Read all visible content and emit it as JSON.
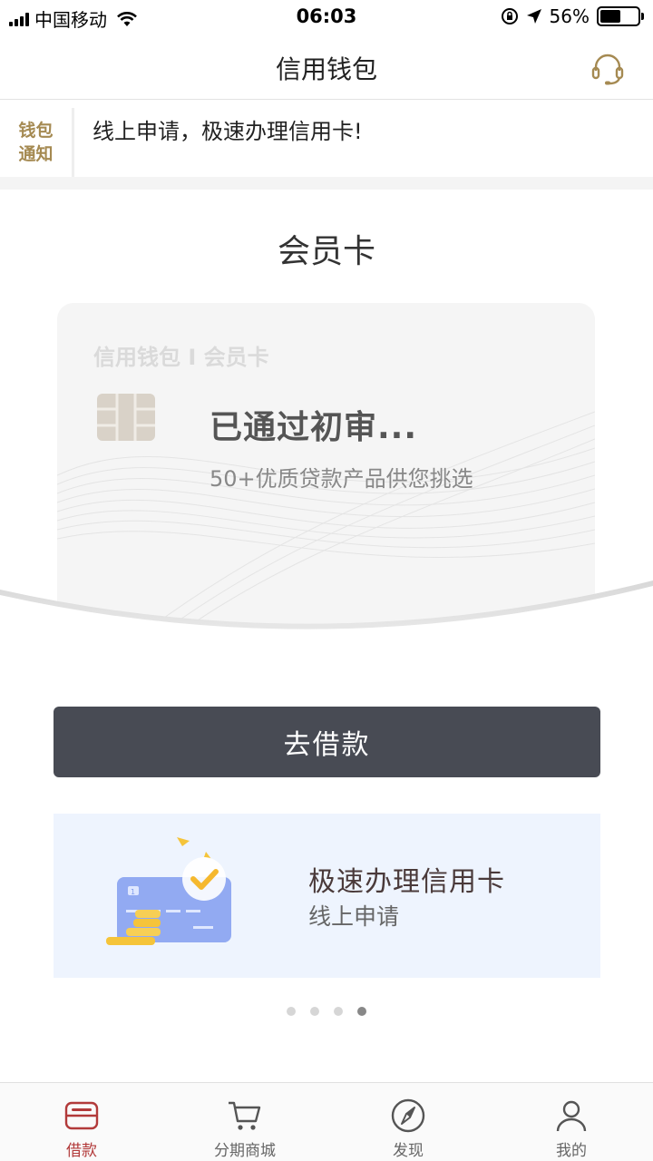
{
  "status_bar": {
    "carrier": "中国移动",
    "time": "06:03",
    "battery": "56%",
    "battery_level": 0.56
  },
  "nav": {
    "title": "信用钱包",
    "service_icon": "headset-icon"
  },
  "notice": {
    "tag_line1": "钱包",
    "tag_line2": "通知",
    "text": "线上申请，极速办理信用卡!"
  },
  "member": {
    "section_title": "会员卡",
    "card_brand": "信用钱包 I 会员卡",
    "card_status": "已通过初审...",
    "card_sub": "50+优质贷款产品供您挑选"
  },
  "borrow_button": {
    "label": "去借款"
  },
  "banner": {
    "title": "极速办理信用卡",
    "subtitle": "线上申请",
    "card_number_hint": "1"
  },
  "carousel": {
    "total": 4,
    "active_index": 3
  },
  "tabs": [
    {
      "label": "借款",
      "icon": "wallet-icon",
      "active": true
    },
    {
      "label": "分期商城",
      "icon": "cart-icon",
      "active": false
    },
    {
      "label": "发现",
      "icon": "compass-icon",
      "active": false
    },
    {
      "label": "我的",
      "icon": "user-icon",
      "active": false
    }
  ],
  "colors": {
    "accent": "#b23a3a",
    "notice_gold": "#a58a52",
    "button_dark": "#484b54",
    "banner_bg": "#eef4fe"
  }
}
